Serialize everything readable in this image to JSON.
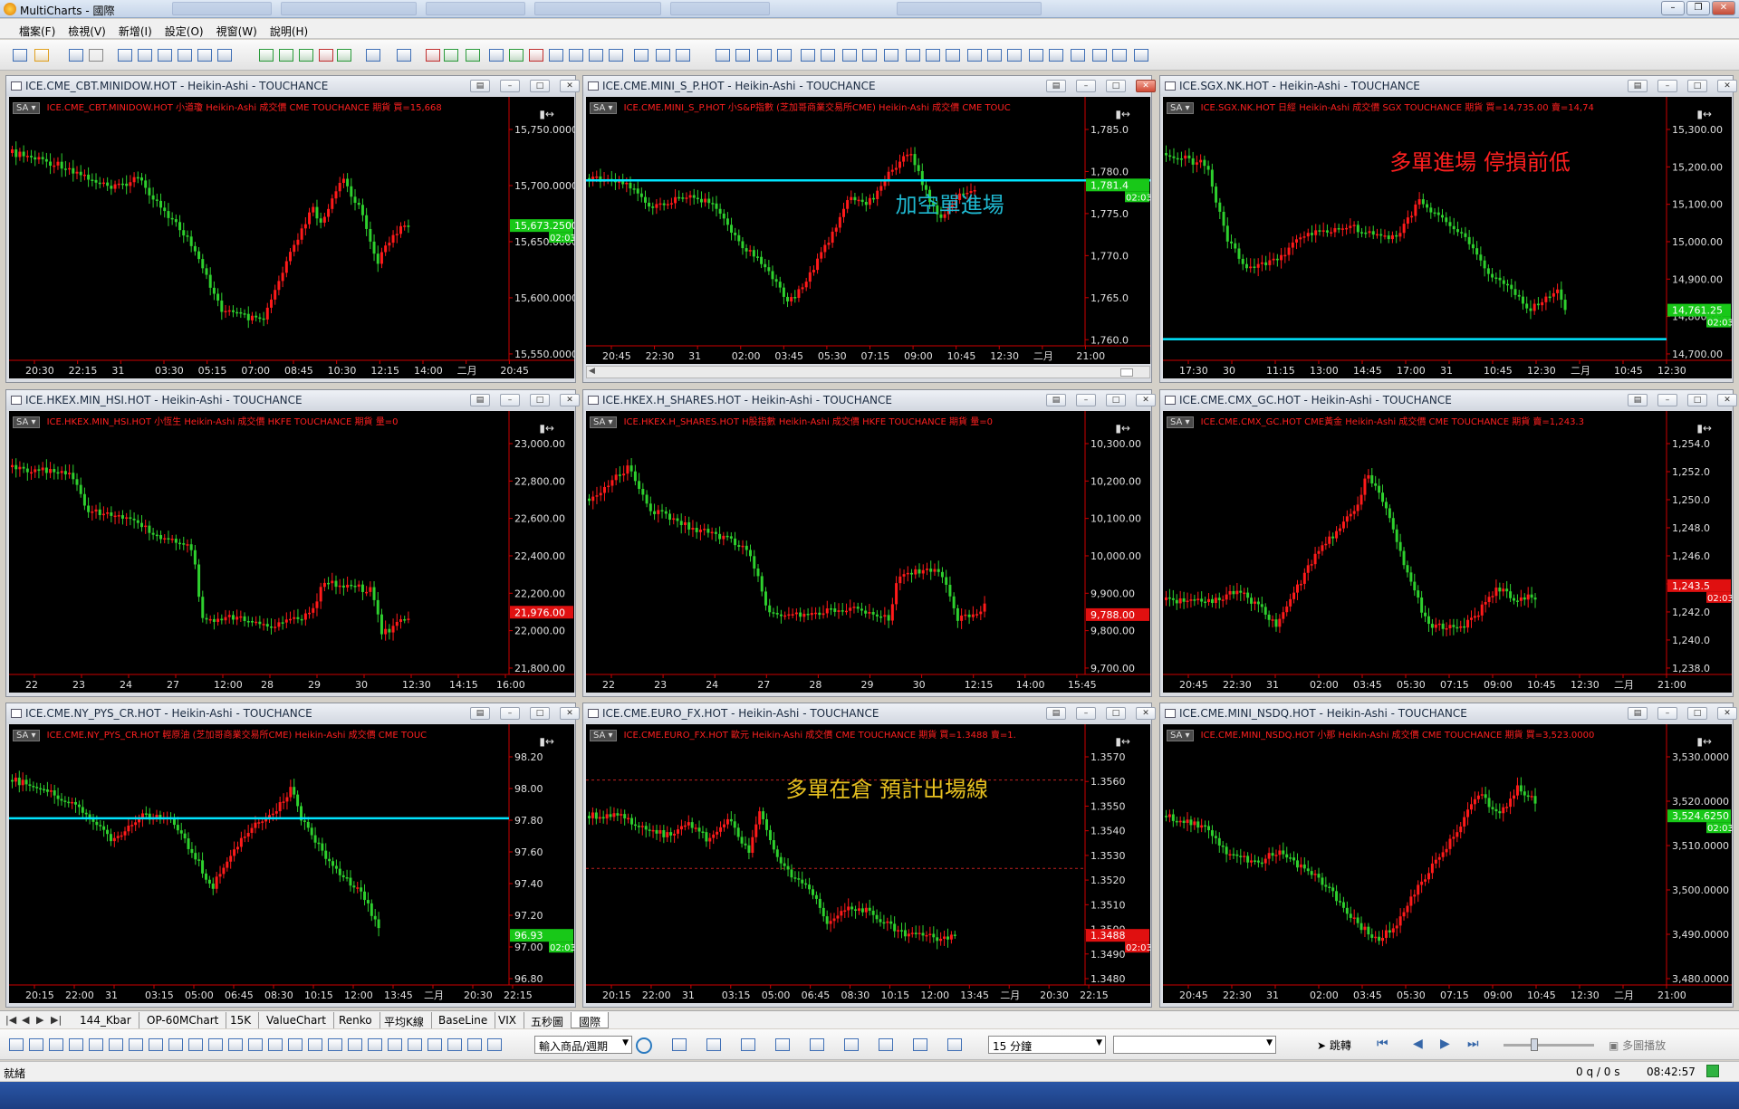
{
  "app": {
    "title": "MultiCharts - 國際"
  },
  "menu": [
    "檔案(F)",
    "檢視(V)",
    "新增(I)",
    "設定(O)",
    "視窗(W)",
    "說明(H)"
  ],
  "colors": {
    "bull": "#ff1a1a",
    "bear": "#2ed02e",
    "cyan_line": "#00e5ff",
    "axis_text": "#e0e0e0",
    "legend_red": "#ff2020"
  },
  "charts": [
    {
      "title": "ICE.CME_CBT.MINIDOW.HOT - Heikin-Ashi - TOUCHANCE",
      "legend": "ICE.CME_CBT.MINIDOW.HOT  小道瓊  Heikin-Ashi  成交價  CME  TOUCHANCE  期貨  買=15,668",
      "y_ticks": [
        "15,750.0000",
        "15,700.0000",
        "15,650.0000",
        "15,600.0000",
        "15,550.0000"
      ],
      "x_ticks": [
        "20:30",
        "22:15",
        "31",
        "03:30",
        "05:15",
        "07:00",
        "08:45",
        "10:30",
        "12:15",
        "14:00",
        "二月",
        "20:45"
      ],
      "price_tag": "15,673.2500",
      "time_tag": "02:03"
    },
    {
      "title": "ICE.CME.MINI_S_P.HOT - Heikin-Ashi - TOUCHANCE",
      "legend": "ICE.CME.MINI_S_P.HOT  小S&P指數 (芝加哥商業交易所CME)  Heikin-Ashi  成交價  CME  TOUC",
      "y_ticks": [
        "1,785.0",
        "1,780.0",
        "1,775.0",
        "1,770.0",
        "1,765.0",
        "1,760.0"
      ],
      "x_ticks": [
        "20:45",
        "22:30",
        "31",
        "02:00",
        "03:45",
        "05:30",
        "07:15",
        "09:00",
        "10:45",
        "12:30",
        "二月",
        "21:00"
      ],
      "price_tag": "1,781.4",
      "time_tag": "02:03",
      "annotation": "加空單進場"
    },
    {
      "title": "ICE.SGX.NK.HOT - Heikin-Ashi - TOUCHANCE",
      "legend": "ICE.SGX.NK.HOT  日經  Heikin-Ashi  成交價  SGX  TOUCHANCE  期貨  買=14,735.00  賣=14,74",
      "y_ticks": [
        "15,300.00",
        "15,200.00",
        "15,100.00",
        "15,000.00",
        "14,900.00",
        "14,800.00",
        "14,700.00"
      ],
      "x_ticks": [
        "17:30",
        "30",
        "11:15",
        "13:00",
        "14:45",
        "17:00",
        "31",
        "10:45",
        "12:30",
        "二月",
        "10:45",
        "12:30"
      ],
      "price_tag": "14,761.25",
      "time_tag": "02:03",
      "annotation": "多單進場 停損前低"
    },
    {
      "title": "ICE.HKEX.MIN_HSI.HOT - Heikin-Ashi - TOUCHANCE",
      "legend": "ICE.HKEX.MIN_HSI.HOT  小恆生  Heikin-Ashi  成交價  HKFE  TOUCHANCE  期貨  量=0",
      "y_ticks": [
        "23,000.00",
        "22,800.00",
        "22,600.00",
        "22,400.00",
        "22,200.00",
        "22,000.00",
        "21,800.00"
      ],
      "x_ticks": [
        "22",
        "23",
        "24",
        "27",
        "12:00",
        "28",
        "29",
        "30",
        "12:30",
        "14:15",
        "16:00"
      ],
      "price_tag": "21,976.00"
    },
    {
      "title": "ICE.HKEX.H_SHARES.HOT - Heikin-Ashi - TOUCHANCE",
      "legend": "ICE.HKEX.H_SHARES.HOT  H股指數  Heikin-Ashi  成交價  HKFE  TOUCHANCE  期貨  量=0",
      "y_ticks": [
        "10,300.00",
        "10,200.00",
        "10,100.00",
        "10,000.00",
        "9,900.00",
        "9,800.00",
        "9,700.00"
      ],
      "x_ticks": [
        "22",
        "23",
        "24",
        "27",
        "28",
        "29",
        "30",
        "12:15",
        "14:00",
        "15:45"
      ],
      "price_tag": "9,788.00"
    },
    {
      "title": "ICE.CME.CMX_GC.HOT - Heikin-Ashi - TOUCHANCE",
      "legend": "ICE.CME.CMX_GC.HOT  CME黃金  Heikin-Ashi  成交價  CME  TOUCHANCE  期貨  賣=1,243.3",
      "y_ticks": [
        "1,254.0",
        "1,252.0",
        "1,250.0",
        "1,248.0",
        "1,246.0",
        "1,244.0",
        "1,242.0",
        "1,240.0",
        "1,238.0"
      ],
      "x_ticks": [
        "20:45",
        "22:30",
        "31",
        "02:00",
        "03:45",
        "05:30",
        "07:15",
        "09:00",
        "10:45",
        "12:30",
        "二月",
        "21:00"
      ],
      "price_tag": "1,243.5",
      "time_tag": "02:03"
    },
    {
      "title": "ICE.CME.NY_PYS_CR.HOT - Heikin-Ashi - TOUCHANCE",
      "legend": "ICE.CME.NY_PYS_CR.HOT  輕原油 (芝加哥商業交易所CME)  Heikin-Ashi  成交價  CME  TOUC",
      "y_ticks": [
        "98.20",
        "98.00",
        "97.80",
        "97.60",
        "97.40",
        "97.20",
        "97.00",
        "96.80"
      ],
      "x_ticks": [
        "20:15",
        "22:00",
        "31",
        "03:15",
        "05:00",
        "06:45",
        "08:30",
        "10:15",
        "12:00",
        "13:45",
        "二月",
        "20:30",
        "22:15"
      ],
      "price_tag": "96.93",
      "time_tag": "02:03"
    },
    {
      "title": "ICE.CME.EURO_FX.HOT - Heikin-Ashi - TOUCHANCE",
      "legend": "ICE.CME.EURO_FX.HOT  歐元  Heikin-Ashi  成交價  CME  TOUCHANCE  期貨  買=1.3488  賣=1.",
      "y_ticks": [
        "1.3570",
        "1.3560",
        "1.3550",
        "1.3540",
        "1.3530",
        "1.3520",
        "1.3510",
        "1.3500",
        "1.3490",
        "1.3480"
      ],
      "x_ticks": [
        "20:15",
        "22:00",
        "31",
        "03:15",
        "05:00",
        "06:45",
        "08:30",
        "10:15",
        "12:00",
        "13:45",
        "二月",
        "20:30",
        "22:15"
      ],
      "price_tag": "1.3488",
      "time_tag": "02:03",
      "annotation": "多單在倉 預計出場線"
    },
    {
      "title": "ICE.CME.MINI_NSDQ.HOT - Heikin-Ashi - TOUCHANCE",
      "legend": "ICE.CME.MINI_NSDQ.HOT  小那  Heikin-Ashi  成交價  CME  TOUCHANCE  期貨  買=3,523.0000",
      "y_ticks": [
        "3,530.0000",
        "3,520.0000",
        "3,510.0000",
        "3,500.0000",
        "3,490.0000",
        "3,480.0000"
      ],
      "x_ticks": [
        "20:45",
        "22:30",
        "31",
        "02:00",
        "03:45",
        "05:30",
        "07:15",
        "09:00",
        "10:45",
        "12:30",
        "二月",
        "21:00"
      ],
      "price_tag": "3,524.6250",
      "time_tag": "02:03"
    }
  ],
  "tabs": [
    "144_Kbar",
    "OP-60MChart",
    "15K",
    "ValueChart",
    "Renko",
    "平均K線",
    "BaseLine",
    "VIX",
    "五秒圖",
    "國際"
  ],
  "active_tab": "國際",
  "drawbar": {
    "symbol_combo": "輸入商品/週期",
    "interval_combo": "15 分鐘",
    "jump_label": "跳轉",
    "multi_play": "多圖播放"
  },
  "status": {
    "left": "就緒",
    "counter": "0 q / 0 s",
    "clock": "08:42:57"
  }
}
